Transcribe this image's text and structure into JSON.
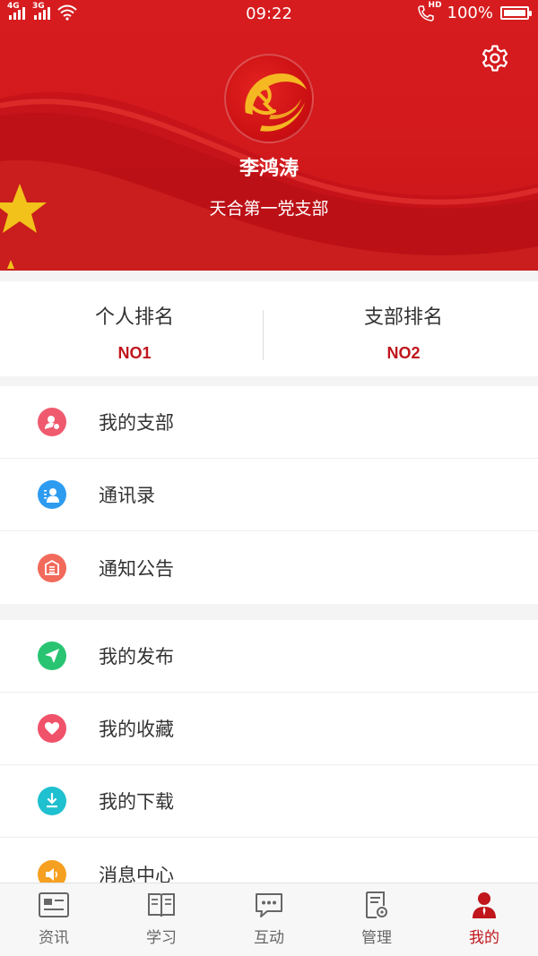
{
  "status_bar": {
    "network1": "4G",
    "network2": "3G",
    "time": "09:22",
    "call_badge": "HD",
    "battery": "100%",
    "battery_level": 1.0
  },
  "profile": {
    "name": "李鸿涛",
    "branch": "天合第一党支部",
    "settings_icon": "gear-icon",
    "avatar_icon": "party-emblem"
  },
  "ranking": {
    "personal_label": "个人排名",
    "personal_value": "NO1",
    "branch_label": "支部排名",
    "branch_value": "NO2"
  },
  "menu_group1": [
    {
      "label": "我的支部",
      "icon": "branch-icon",
      "color": "#f05a6e"
    },
    {
      "label": "通讯录",
      "icon": "contacts-icon",
      "color": "#2d9cf0"
    },
    {
      "label": "通知公告",
      "icon": "notice-icon",
      "color": "#f26a5b"
    }
  ],
  "menu_group2": [
    {
      "label": "我的发布",
      "icon": "send-icon",
      "color": "#29c472"
    },
    {
      "label": "我的收藏",
      "icon": "heart-icon",
      "color": "#f0526a"
    },
    {
      "label": "我的下载",
      "icon": "download-icon",
      "color": "#1fc0cf"
    },
    {
      "label": "消息中心",
      "icon": "message-icon",
      "color": "#f5a021"
    }
  ],
  "tabs": [
    {
      "label": "资讯",
      "icon": "news-icon",
      "active": false
    },
    {
      "label": "学习",
      "icon": "book-icon",
      "active": false
    },
    {
      "label": "互动",
      "icon": "chat-icon",
      "active": false
    },
    {
      "label": "管理",
      "icon": "manage-icon",
      "active": false
    },
    {
      "label": "我的",
      "icon": "user-icon",
      "active": true
    }
  ],
  "colors": {
    "header_red": "#d61c1f",
    "accent_red": "#c0161c",
    "text": "#333333"
  }
}
